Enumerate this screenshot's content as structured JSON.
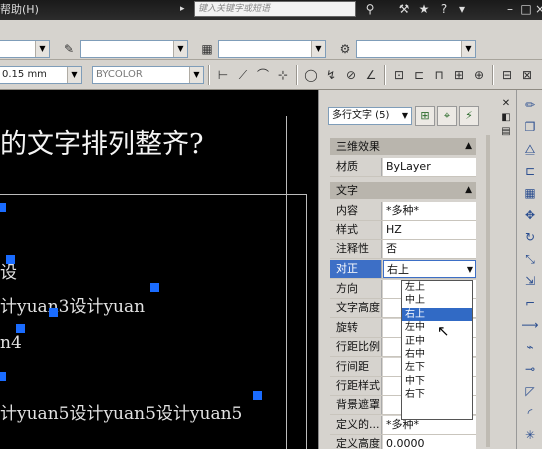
{
  "titlebar": {
    "menu_help": "帮助(H)",
    "search_placeholder": "键入关键字或短语"
  },
  "toolbar": {
    "lineweight": "0.15 mm",
    "color": "BYCOLOR"
  },
  "canvas": {
    "heading": "的文字排列整齐?",
    "lines": [
      "设",
      "计yuan3设计yuan",
      "n4",
      "计yuan5设计yuan5设计yuan5"
    ]
  },
  "properties": {
    "selection": "多行文字 (5)",
    "sections": {
      "3d": "三维效果",
      "text": "文字"
    },
    "rows": [
      {
        "key": "材质",
        "value": "ByLayer"
      },
      {
        "key": "内容",
        "value": "*多种*"
      },
      {
        "key": "样式",
        "value": "HZ"
      },
      {
        "key": "注释性",
        "value": "否"
      },
      {
        "key": "对正",
        "value": "右上"
      },
      {
        "key": "方向",
        "value": ""
      },
      {
        "key": "文字高度",
        "value": ""
      },
      {
        "key": "旋转",
        "value": ""
      },
      {
        "key": "行距比例",
        "value": ""
      },
      {
        "key": "行间距",
        "value": ""
      },
      {
        "key": "行距样式",
        "value": ""
      },
      {
        "key": "背景遮罩",
        "value": ""
      },
      {
        "key": "定义的...",
        "value": "*多种*"
      },
      {
        "key": "定义高度",
        "value": "0.0000"
      }
    ],
    "justify_options": [
      "左上",
      "中上",
      "右上",
      "左中",
      "正中",
      "右中",
      "左下",
      "中下",
      "右下"
    ],
    "selected_option": "右上"
  },
  "colors": {
    "canvas_bg": "#000000",
    "grip": "#1a6cff",
    "highlight": "#3d6fc6",
    "panel_bg": "#d6d3ce"
  }
}
